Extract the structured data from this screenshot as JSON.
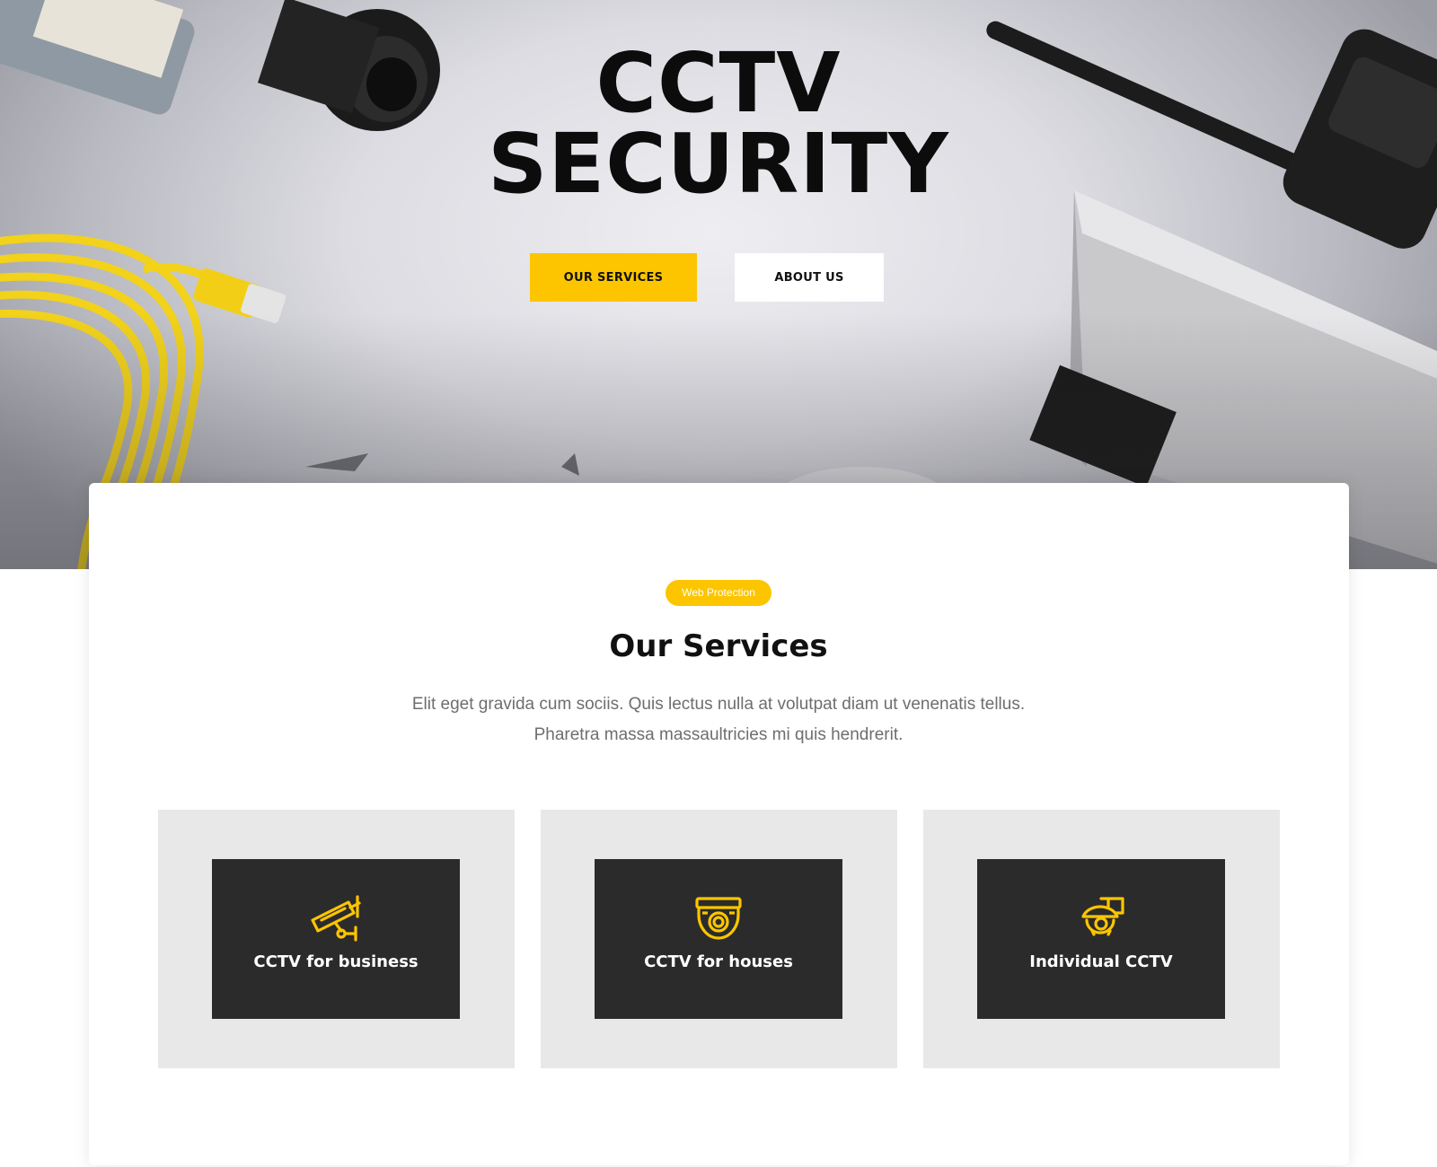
{
  "hero": {
    "title_line1": "CCTV",
    "title_line2": "SECURITY",
    "services_button": "OUR SERVICES",
    "about_button": "ABOUT US"
  },
  "section": {
    "badge": "Web Protection",
    "title": "Our Services",
    "description_line1": "Elit eget gravida cum sociis. Quis lectus nulla at volutpat diam ut venenatis tellus.",
    "description_line2": "Pharetra massa massaultricies mi quis hendrerit."
  },
  "services": [
    {
      "label": "CCTV for business",
      "icon": "security-camera-icon"
    },
    {
      "label": "CCTV for houses",
      "icon": "dome-camera-icon"
    },
    {
      "label": "Individual CCTV",
      "icon": "speed-dome-camera-icon"
    }
  ],
  "colors": {
    "accent": "#fcc500",
    "dark_card": "#2b2b2b",
    "card_bg": "#e9e8e9",
    "text_muted": "#6e6e6e"
  }
}
